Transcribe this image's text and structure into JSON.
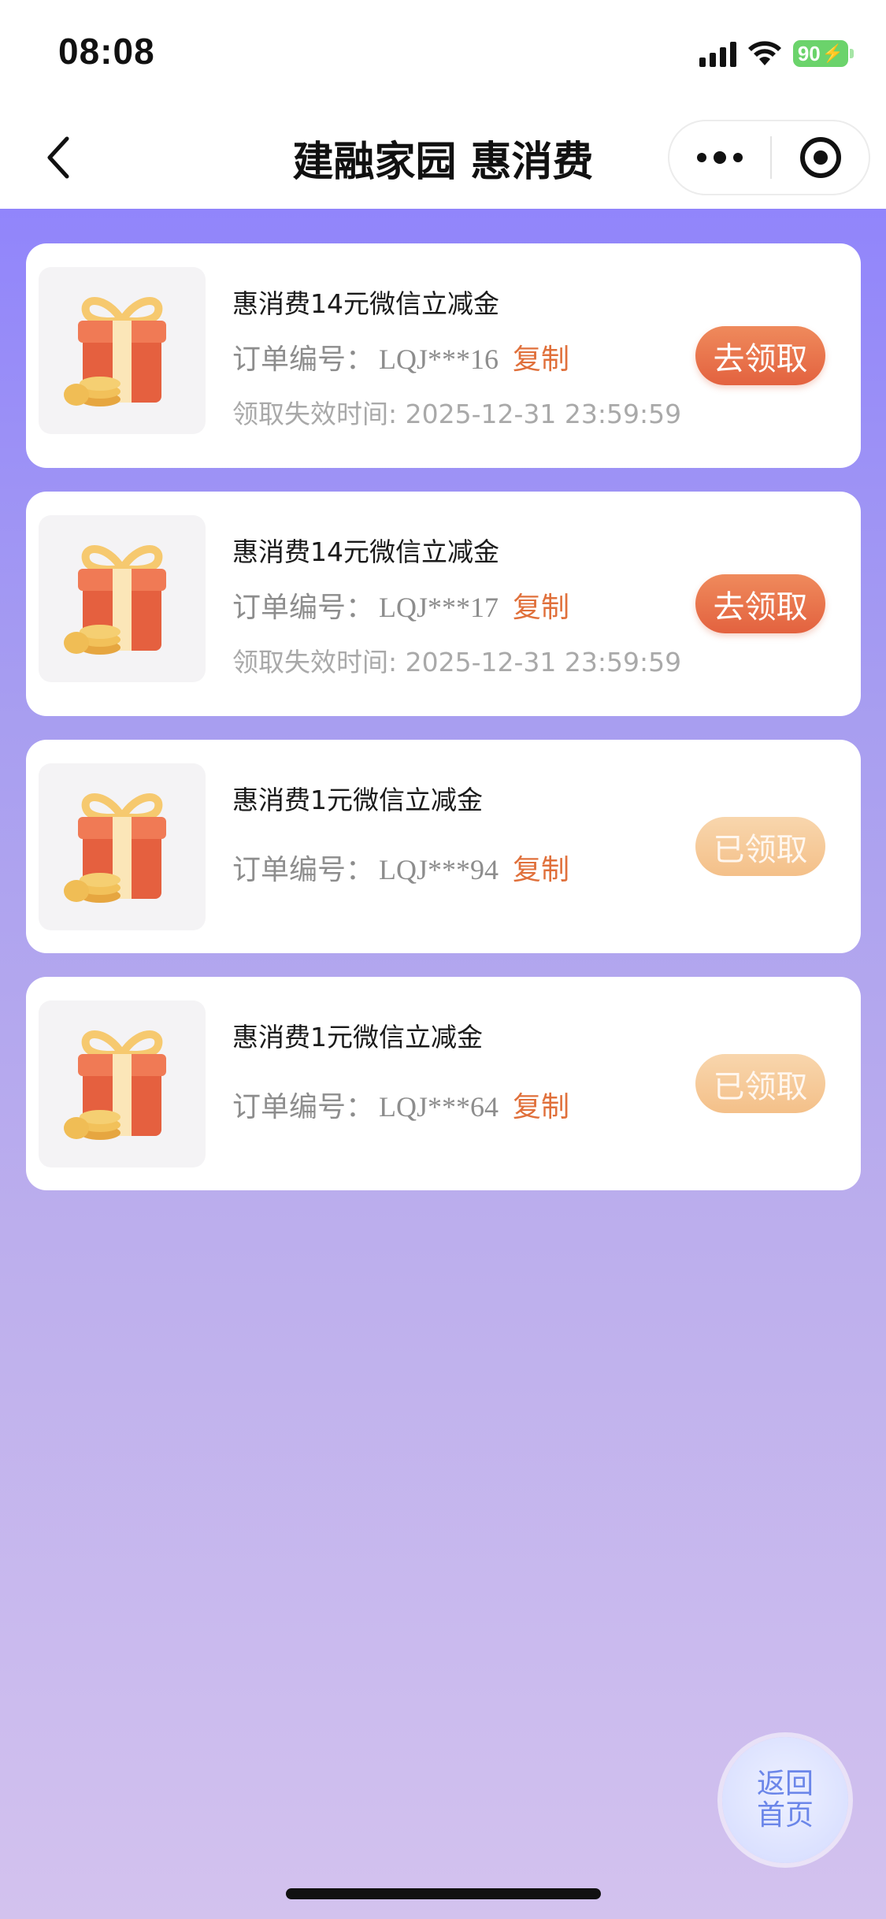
{
  "status_bar": {
    "time": "08:08",
    "battery": "90"
  },
  "nav": {
    "title": "建融家园 惠消费"
  },
  "cards": [
    {
      "title": "惠消费14元微信立减金",
      "order_label": "订单编号：",
      "order_no": "LQJ***16",
      "copy_label": "复制",
      "expire_text": "领取失效时间: 2025-12-31 23:59:59",
      "button_label": "去领取",
      "status": "active"
    },
    {
      "title": "惠消费14元微信立减金",
      "order_label": "订单编号：",
      "order_no": "LQJ***17",
      "copy_label": "复制",
      "expire_text": "领取失效时间: 2025-12-31 23:59:59",
      "button_label": "去领取",
      "status": "active"
    },
    {
      "title": "惠消费1元微信立减金",
      "order_label": "订单编号：",
      "order_no": "LQJ***94",
      "copy_label": "复制",
      "button_label": "已领取",
      "status": "claimed"
    },
    {
      "title": "惠消费1元微信立减金",
      "order_label": "订单编号：",
      "order_no": "LQJ***64",
      "copy_label": "复制",
      "button_label": "已领取",
      "status": "claimed"
    }
  ],
  "home_button": {
    "line1": "返回",
    "line2": "首页"
  },
  "icons": {
    "back": "chevron-left-icon",
    "more": "more-dots-icon",
    "close": "close-circle-icon",
    "gift": "gift-box-icon"
  },
  "colors": {
    "accent": "#e3623f",
    "copy_link": "#e0703b",
    "claimed": "#f4c089",
    "background_top": "#9185fb",
    "background_bottom": "#d3c2ee"
  }
}
